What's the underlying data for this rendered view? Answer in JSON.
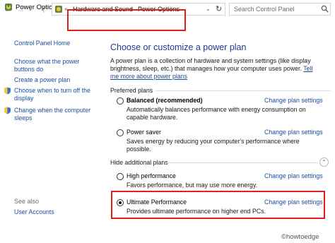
{
  "window": {
    "title": "Power Options",
    "controls": {
      "minimize": "—",
      "maximize": "☐",
      "close": "✕"
    }
  },
  "address_bar": {
    "breadcrumbs": [
      "Hardware and Sound",
      "Power Options"
    ],
    "separator": "›",
    "overflow": "«",
    "search_placeholder": "Search Control Panel"
  },
  "sidebar": {
    "home": "Control Panel Home",
    "items": [
      "Choose what the power buttons do",
      "Create a power plan",
      "Choose when to turn off the display",
      "Change when the computer sleeps"
    ],
    "see_also_label": "See also",
    "see_also_items": [
      "User Accounts"
    ]
  },
  "main": {
    "heading": "Choose or customize a power plan",
    "description": "A power plan is a collection of hardware and system settings (like display brightness, sleep, etc.) that manages how your computer uses power.",
    "description_link": "Tell me more about power plans",
    "preferred_label": "Preferred plans",
    "hidden_label": "Hide additional plans",
    "change_link_label": "Change plan settings",
    "plans": [
      {
        "name": "Balanced (recommended)",
        "desc": "Automatically balances performance with energy consumption on capable hardware.",
        "selected": false
      },
      {
        "name": "Power saver",
        "desc": "Saves energy by reducing your computer's performance where possible.",
        "selected": false
      },
      {
        "name": "High performance",
        "desc": "Favors performance, but may use more energy.",
        "selected": false
      },
      {
        "name": "Ultimate Performance",
        "desc": "Provides ultimate performance on higher end PCs.",
        "selected": true
      }
    ]
  },
  "highlight_color": "#e02020",
  "link_color": "#1a4d9c",
  "icons": [
    "power-options-icon",
    "back-arrow-icon",
    "forward-arrow-icon",
    "up-arrow-icon",
    "refresh-icon",
    "search-icon",
    "shield-icon",
    "collapse-icon"
  ],
  "watermark": "©howtoedge"
}
